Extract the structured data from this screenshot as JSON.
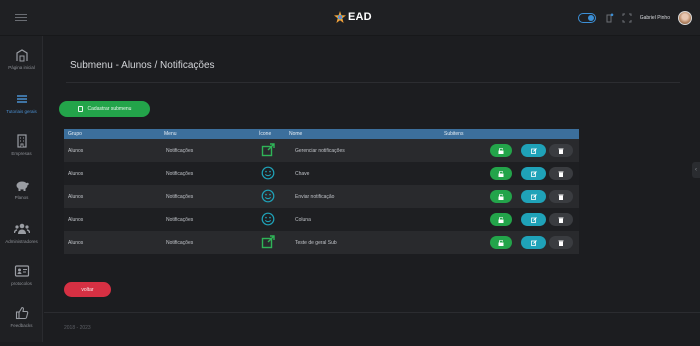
{
  "header": {
    "logo_text": "EAD",
    "user_name": "Gabriel Pinho"
  },
  "sidebar": {
    "items": [
      {
        "label": "Página inicial",
        "icon": "building-icon"
      },
      {
        "label": "Tutoriais gerais",
        "icon": "menu-icon"
      },
      {
        "label": "Empresas",
        "icon": "office-icon"
      },
      {
        "label": "Planos",
        "icon": "piggy-bank-icon"
      },
      {
        "label": "Administradores",
        "icon": "users-icon"
      },
      {
        "label": "protocolos",
        "icon": "id-card-icon"
      },
      {
        "label": "Feedbacks",
        "icon": "thumbs-up-icon"
      }
    ]
  },
  "page": {
    "title": "Submenu - Alunos / Notificações",
    "register_button": "Cadastrar submenu",
    "back_button": "voltar",
    "footer": "2018 - 2023"
  },
  "table": {
    "headers": {
      "group": "Grupo",
      "menu": "Menu",
      "icon": "Ícone",
      "name": "Nome",
      "subitems": "Subitens"
    },
    "rows": [
      {
        "group": "Alunos",
        "menu": "Notificações",
        "icon": "external-link-icon",
        "name": "Gerenciar notificações"
      },
      {
        "group": "Alunos",
        "menu": "Notificações",
        "icon": "smile-icon",
        "name": "Chave"
      },
      {
        "group": "Alunos",
        "menu": "Notificações",
        "icon": "smile-icon",
        "name": "Enviar notificação"
      },
      {
        "group": "Alunos",
        "menu": "Notificações",
        "icon": "smile-icon",
        "name": "Coluna"
      },
      {
        "group": "Alunos",
        "menu": "Notificações",
        "icon": "external-link-icon",
        "name": "Teste de geral Sub"
      }
    ]
  },
  "colors": {
    "accent_green": "#23a44a",
    "accent_blue": "#1fa2b8",
    "danger_red": "#d63043",
    "table_header": "#3c6f9c",
    "active_nav": "#4a8fd0"
  }
}
